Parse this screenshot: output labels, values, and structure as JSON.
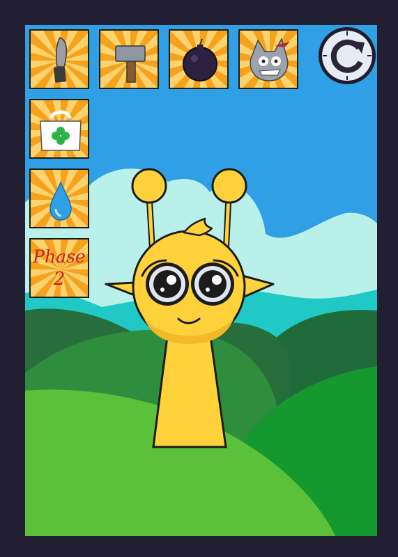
{
  "toolbar": {
    "buttons": [
      {
        "name": "knife",
        "icon": "knife-icon"
      },
      {
        "name": "hammer",
        "icon": "hammer-icon"
      },
      {
        "name": "bomb",
        "icon": "bomb-icon"
      },
      {
        "name": "monster",
        "icon": "gray-monster-icon"
      },
      {
        "name": "medkit",
        "icon": "medkit-icon"
      },
      {
        "name": "water",
        "icon": "water-drop-icon"
      }
    ],
    "phase_button": {
      "line1": "Phase",
      "line2": "2"
    },
    "reset_icon": "reset-arrow-icon"
  },
  "colors": {
    "frame": "#231f33",
    "sky": "#2f9fe6",
    "button_ray_light": "#fcd36e",
    "button_ray_dark": "#f6a21d",
    "character": "#ffd23c",
    "phase_text": "#cf1a1a"
  }
}
